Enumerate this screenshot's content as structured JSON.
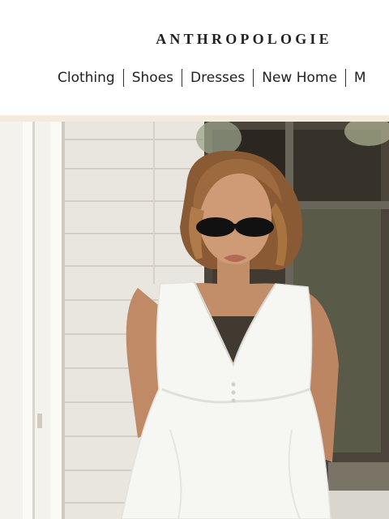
{
  "brand": {
    "name": "ANTHROPOLOGIE"
  },
  "nav": {
    "items": [
      {
        "label": "Clothing"
      },
      {
        "label": "Shoes"
      },
      {
        "label": "Dresses"
      },
      {
        "label": "New Home"
      },
      {
        "label": "M"
      }
    ]
  },
  "hero": {
    "subject": "woman-in-white-dress-with-sunglasses"
  },
  "colors": {
    "band": "#f4ebdd",
    "text": "#222222"
  }
}
